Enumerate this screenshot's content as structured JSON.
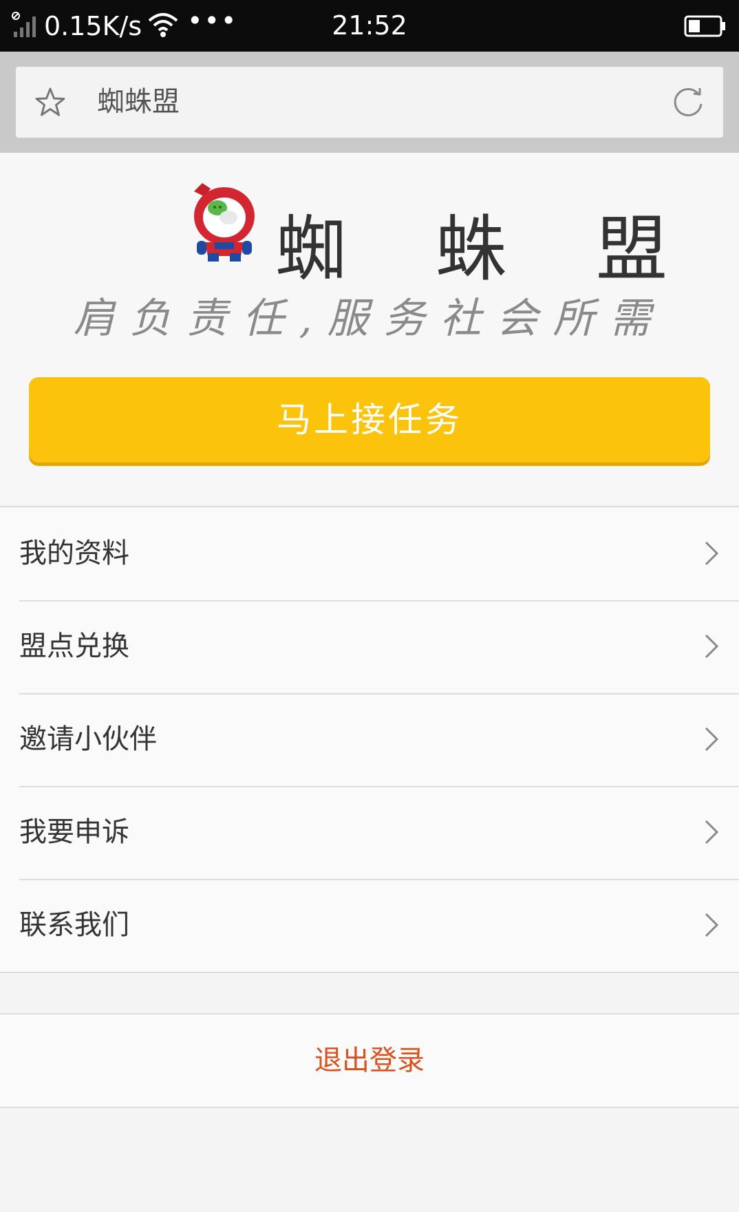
{
  "status_bar": {
    "network_speed": "0.15K/s",
    "more": "•••",
    "time": "21:52",
    "icons": [
      "signal-icon",
      "wifi-icon",
      "battery-icon"
    ]
  },
  "browser": {
    "address_text": "蜘蛛盟",
    "icons": [
      "star-icon",
      "refresh-icon"
    ]
  },
  "hero": {
    "title": "蜘 蛛 盟",
    "slogan": "肩负责任,服务社会所需",
    "cta_label": "马上接任务",
    "cta_color": "#fbc30b"
  },
  "menu": {
    "items": [
      {
        "label": "我的资料"
      },
      {
        "label": "盟点兑换"
      },
      {
        "label": "邀请小伙伴"
      },
      {
        "label": "我要申诉"
      },
      {
        "label": "联系我们"
      }
    ]
  },
  "logout": {
    "label": "退出登录",
    "color": "#d9531e"
  }
}
